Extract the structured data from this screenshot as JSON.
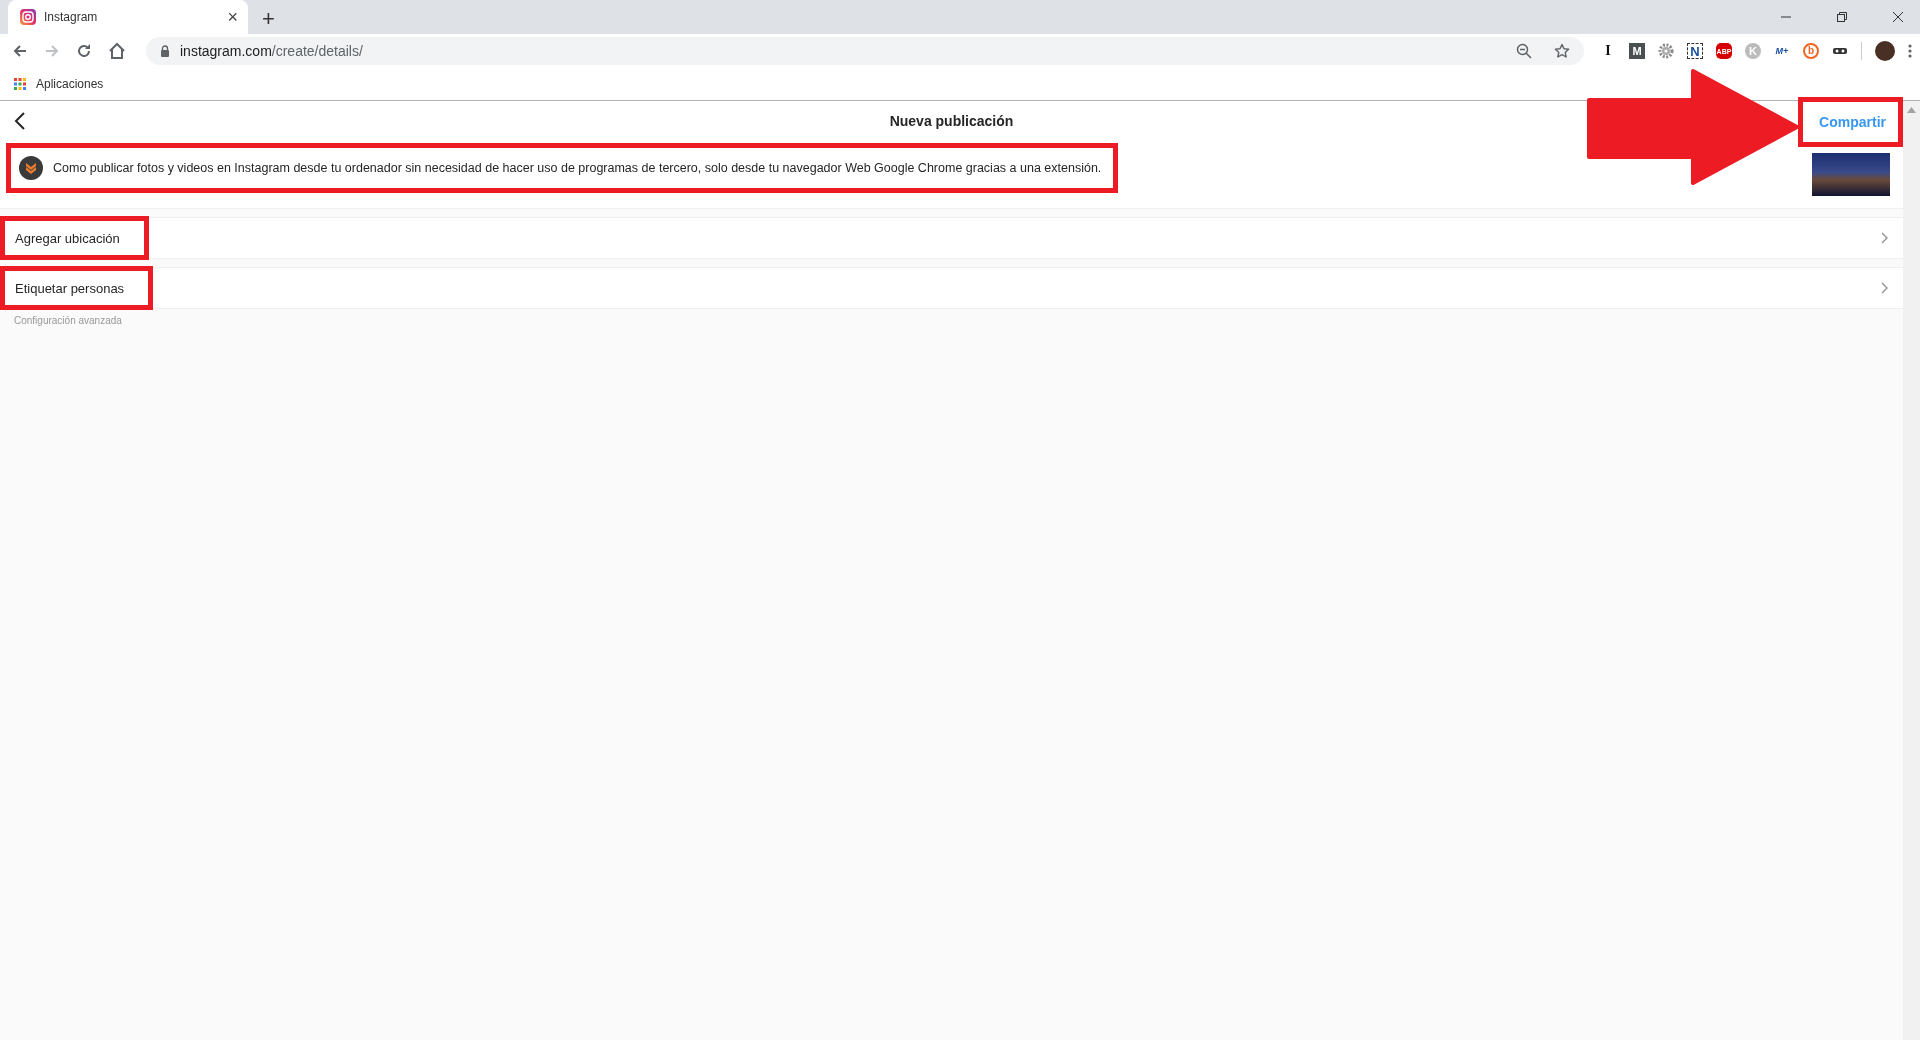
{
  "browser": {
    "tab": {
      "title": "Instagram",
      "close": "×"
    },
    "new_tab": "+",
    "url": {
      "host": "instagram.com",
      "path": "/create/details/"
    },
    "extensions": [
      {
        "kind": "letter",
        "text": "I"
      },
      {
        "kind": "tile",
        "text": "M"
      },
      {
        "kind": "gear"
      },
      {
        "kind": "frame",
        "text": "N"
      },
      {
        "kind": "stop",
        "text": "ABP"
      },
      {
        "kind": "circle",
        "text": "K"
      },
      {
        "kind": "plain",
        "text": "M+"
      },
      {
        "kind": "ring",
        "text": "b"
      },
      {
        "kind": "mask"
      }
    ],
    "bookmarks": [
      {
        "label": "Aplicaciones"
      }
    ]
  },
  "page": {
    "title": "Nueva publicación",
    "share": "Compartir",
    "caption": "Como publicar fotos y videos en Instagram desde tu ordenador sin necesidad de hacer uso de programas de tercero, solo desde tu navegador Web Google Chrome gracias a una extensión.",
    "options": [
      {
        "label": "Agregar ubicación"
      },
      {
        "label": "Etiquetar personas"
      }
    ],
    "advanced": "Configuración avanzada"
  }
}
